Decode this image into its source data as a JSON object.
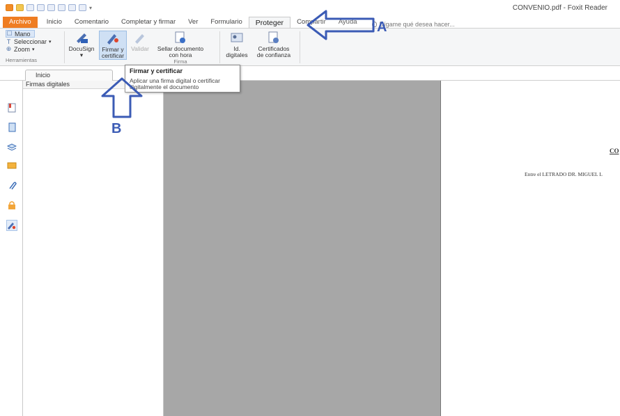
{
  "window": {
    "title": "CONVENIO.pdf - Foxit Reader"
  },
  "tabs": [
    {
      "label": "Archivo"
    },
    {
      "label": "Inicio"
    },
    {
      "label": "Comentario"
    },
    {
      "label": "Completar y firmar"
    },
    {
      "label": "Ver"
    },
    {
      "label": "Formulario"
    },
    {
      "label": "Proteger"
    },
    {
      "label": "Compartir"
    },
    {
      "label": "Ayuda"
    }
  ],
  "tell_me": {
    "placeholder": "Dígame qué desea hacer..."
  },
  "tools_group": {
    "items": [
      "Mano",
      "Seleccionar",
      "Zoom"
    ],
    "label": "Herramientas"
  },
  "ribbon_buttons": {
    "docusign": "DocuSign",
    "firmar_line1": "Firmar y",
    "firmar_line2": "certificar",
    "validar": "Validar",
    "sellar_line1": "Sellar documento",
    "sellar_line2": "con hora",
    "id_line1": "Id.",
    "id_line2": "digitales",
    "cert_line1": "Certificados",
    "cert_line2": "de confianza",
    "firma_group_label": "Firma"
  },
  "tooltip": {
    "title": "Firmar y certificar",
    "line1": "Aplicar una firma digital o certificar",
    "line2": "digitalmente el documento"
  },
  "doc_tab": {
    "label": "Inicio"
  },
  "panel": {
    "title": "Firmas digitales"
  },
  "document": {
    "heading": "CO",
    "line1": "Entre el LETRADO DR. MIGUEL L"
  },
  "annotations": {
    "label_a": "A",
    "label_b": "B",
    "color": "#3b5bb5"
  },
  "colors": {
    "file_tab": "#ef7d22",
    "ribbon_bg": "#f5f6f7",
    "workspace_gray": "#a7a7a7"
  }
}
